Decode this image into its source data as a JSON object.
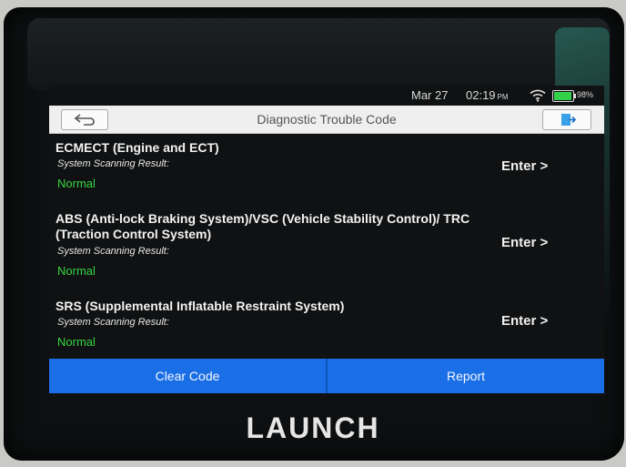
{
  "status_bar": {
    "date": "Mar 27",
    "time": "02:19",
    "ampm": "PM",
    "battery": "98%",
    "battery_level": 0.98
  },
  "header": {
    "title": "Diagnostic Trouble Code"
  },
  "systems": [
    {
      "name": "ECMECT (Engine and ECT)",
      "label": "System Scanning Result:",
      "status": "Normal",
      "action": "Enter >"
    },
    {
      "name": "ABS (Anti-lock Braking System)/VSC (Vehicle Stability Control)/ TRC (Traction Control System)",
      "label": "System Scanning Result:",
      "status": "Normal",
      "action": "Enter >"
    },
    {
      "name": "SRS (Supplemental Inflatable Restraint System)",
      "label": "System Scanning Result:",
      "status": "Normal",
      "action": "Enter >"
    }
  ],
  "footer": {
    "clear_label": "Clear Code",
    "report_label": "Report"
  },
  "device": {
    "brand": "LAUNCH"
  },
  "colors": {
    "accent": "#1a6fe6",
    "status_ok": "#37d643",
    "background": "#101112"
  },
  "icons": {
    "back": "back-arrow-icon",
    "exit": "exit-icon",
    "wifi": "wifi-icon",
    "battery": "battery-icon"
  }
}
